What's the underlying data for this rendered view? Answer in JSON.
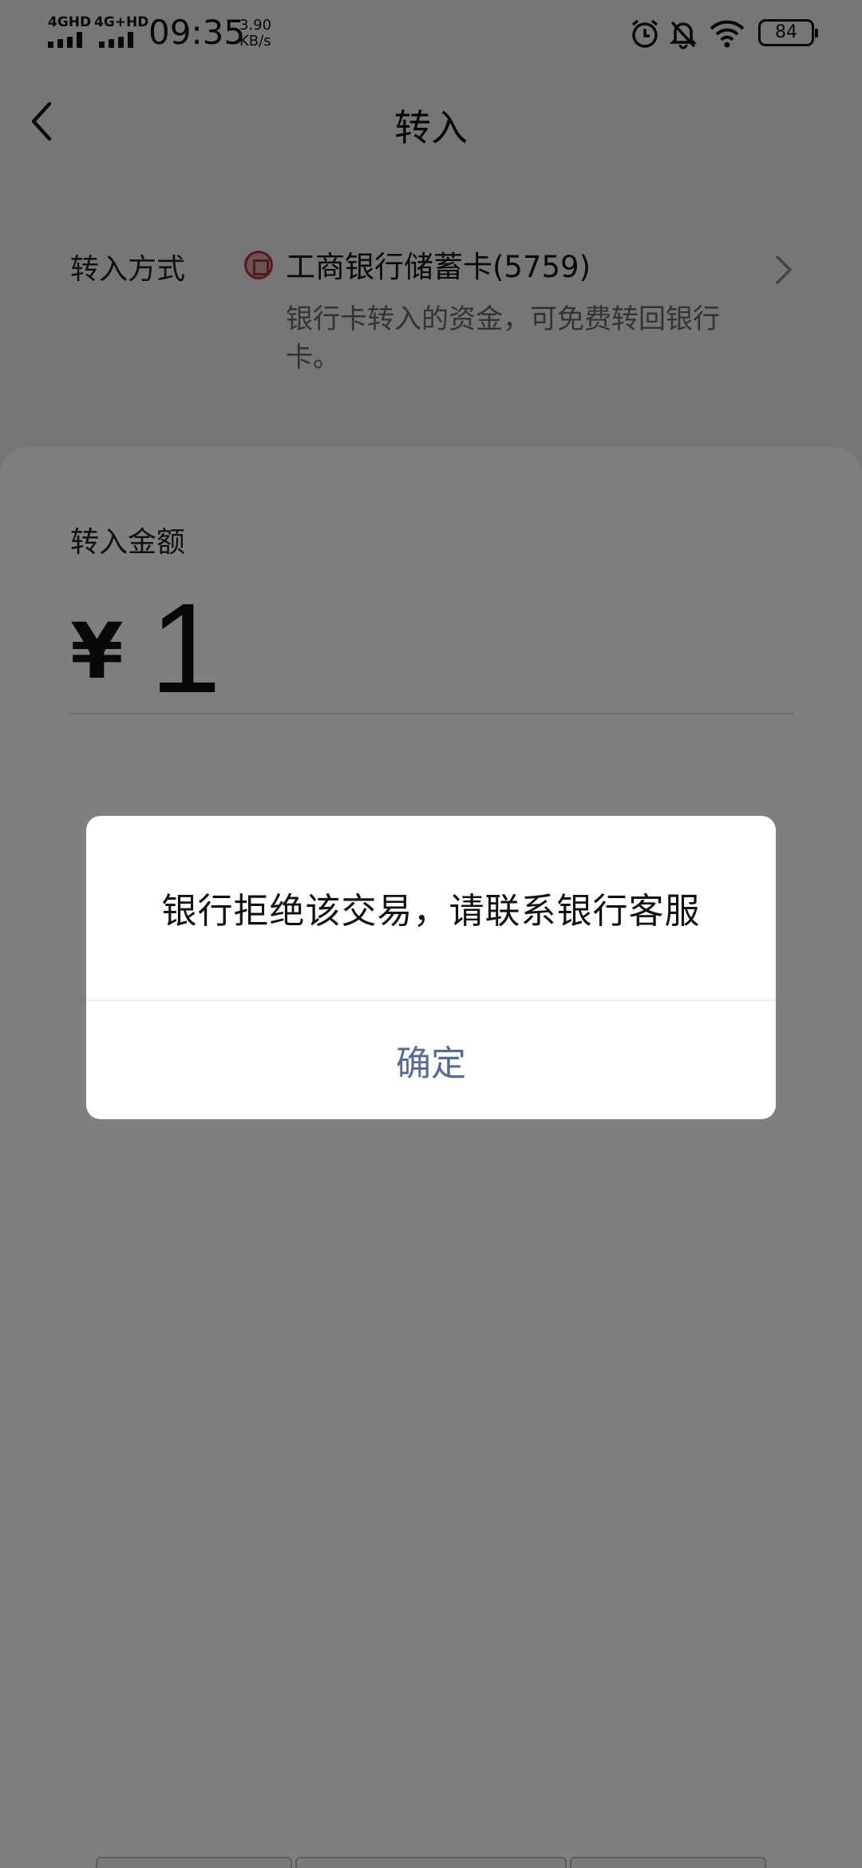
{
  "status_bar": {
    "network_1": "4GHD",
    "network_2": "4G+HD",
    "time": "09:35",
    "speed_value": "3.90",
    "speed_unit": "KB/s",
    "battery": "84",
    "icons": [
      "alarm-icon",
      "bell-off-icon",
      "wifi-icon",
      "battery-icon"
    ]
  },
  "nav": {
    "title": "转入"
  },
  "transfer_method": {
    "label": "转入方式",
    "bank_name": "工商银行储蓄卡(5759)",
    "description": "银行卡转入的资金，可免费转回银行卡。"
  },
  "amount": {
    "label": "转入金额",
    "currency": "¥",
    "value": "1"
  },
  "dialog": {
    "message": "银行拒绝该交易，请联系银行客服",
    "confirm_label": "确定"
  },
  "colors": {
    "link_blue": "#576b95",
    "bank_red": "#a1393c",
    "mask": "rgba(0,0,0,0.5)"
  }
}
